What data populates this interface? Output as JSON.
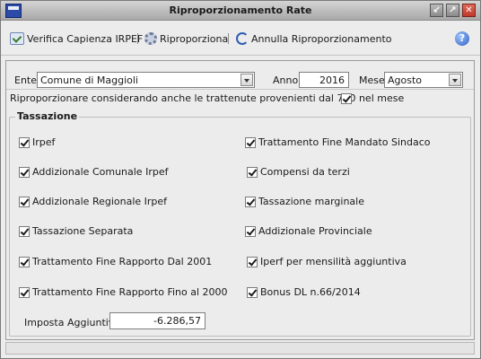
{
  "window": {
    "title": "Riproporzionamento Rate"
  },
  "toolbar": {
    "verifica_label": "Verifica Capienza IRPEF",
    "riproporziona_label": "Riproporziona",
    "annulla_label": "Annulla Riproporzionamento"
  },
  "filters": {
    "ente_label": "Ente",
    "ente_value": "Comune di Maggioli",
    "anno_label": "Anno",
    "anno_value": "2016",
    "mese_label": "Mese",
    "mese_value": "Agosto"
  },
  "option_730": {
    "label": "Riproporzionare considerando anche le trattenute provenienti dal 730 nel mese",
    "checked": true
  },
  "tassazione": {
    "title": "Tassazione",
    "left": [
      {
        "label": "Irpef",
        "checked": true
      },
      {
        "label": "Addizionale Comunale Irpef",
        "checked": true
      },
      {
        "label": "Addizionale Regionale Irpef",
        "checked": true
      },
      {
        "label": "Tassazione Separata",
        "checked": true
      },
      {
        "label": "Trattamento Fine Rapporto Dal 2001",
        "checked": true
      },
      {
        "label": "Trattamento Fine Rapporto Fino al 2000",
        "checked": true
      }
    ],
    "right": [
      {
        "label": "Trattamento Fine Mandato Sindaco",
        "checked": true
      },
      {
        "label": "Compensi da terzi",
        "checked": true
      },
      {
        "label": "Tassazione marginale",
        "checked": true
      },
      {
        "label": "Addizionale Provinciale",
        "checked": true
      },
      {
        "label": "Iperf per mensilità aggiuntiva",
        "checked": true
      },
      {
        "label": "Bonus DL n.66/2014",
        "checked": true
      }
    ],
    "imposta_label": "Imposta Aggiuntiva",
    "imposta_value": "-6.286,57"
  }
}
